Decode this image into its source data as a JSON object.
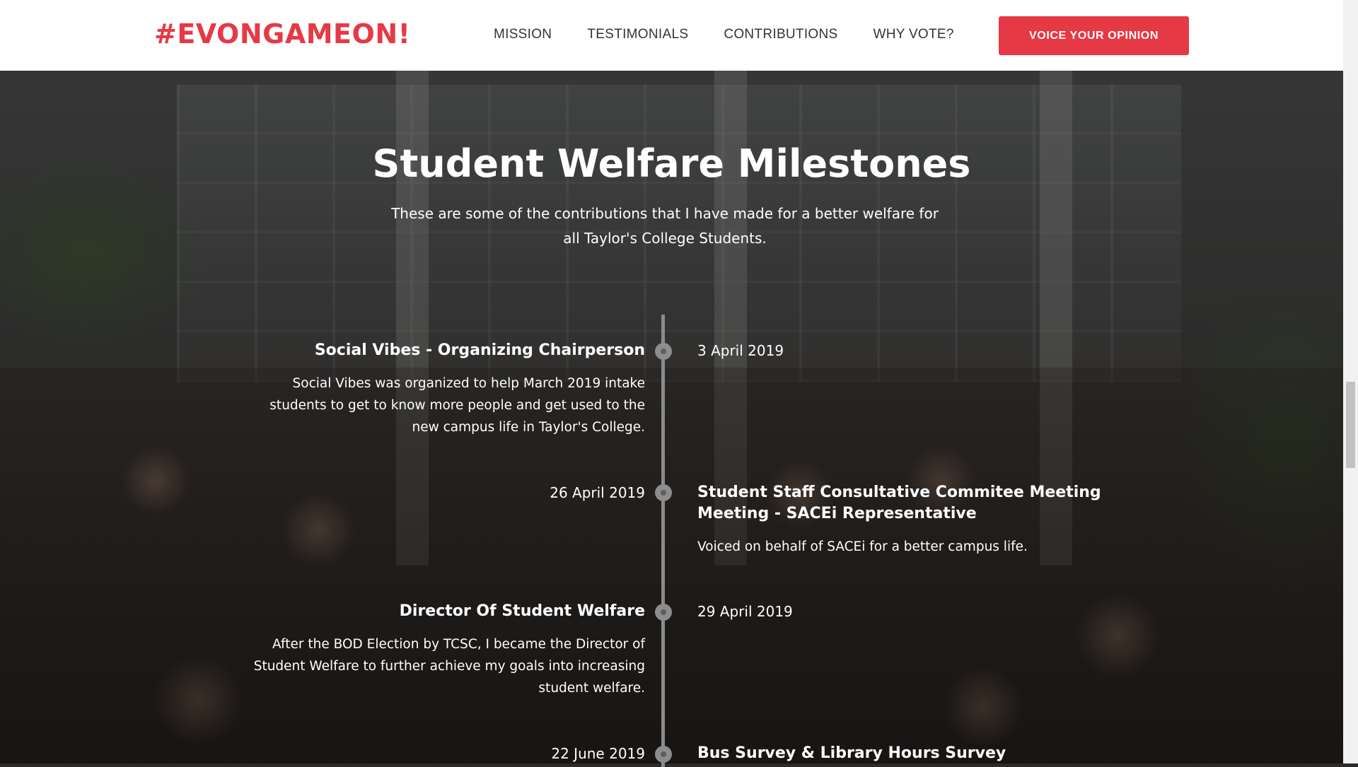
{
  "header": {
    "logo": "#EVONGAMEON!",
    "nav": [
      "MISSION",
      "TESTIMONIALS",
      "CONTRIBUTIONS",
      "WHY VOTE?"
    ],
    "cta_label": "VOICE YOUR OPINION"
  },
  "section": {
    "title": "Student Welfare Milestones",
    "subtitle": "These are some of the contributions that I have made for a better welfare for all Taylor's College Students."
  },
  "timeline": [
    {
      "title": "Social Vibes - Organizing Chairperson",
      "description": "Social Vibes was organized to help March 2019 intake students to get to know more people and get used to the new campus life in Taylor's College.",
      "date": "3 April 2019"
    },
    {
      "title": "Student Staff Consultative Commitee Meeting Meeting - SACEi Representative",
      "description": "Voiced on behalf of SACEi for a better campus life.",
      "date": "26 April 2019"
    },
    {
      "title": "Director Of Student Welfare",
      "description": "After the BOD Election by TCSC, I became the Director of Student Welfare to further achieve my goals into increasing student welfare.",
      "date": "29 April 2019"
    },
    {
      "title": "Bus Survey & Library Hours Survey",
      "description": "",
      "date": "22 June 2019"
    }
  ],
  "colors": {
    "accent": "#e63946",
    "header_bg": "#ffffff",
    "timeline_line": "#8b8b8b"
  }
}
